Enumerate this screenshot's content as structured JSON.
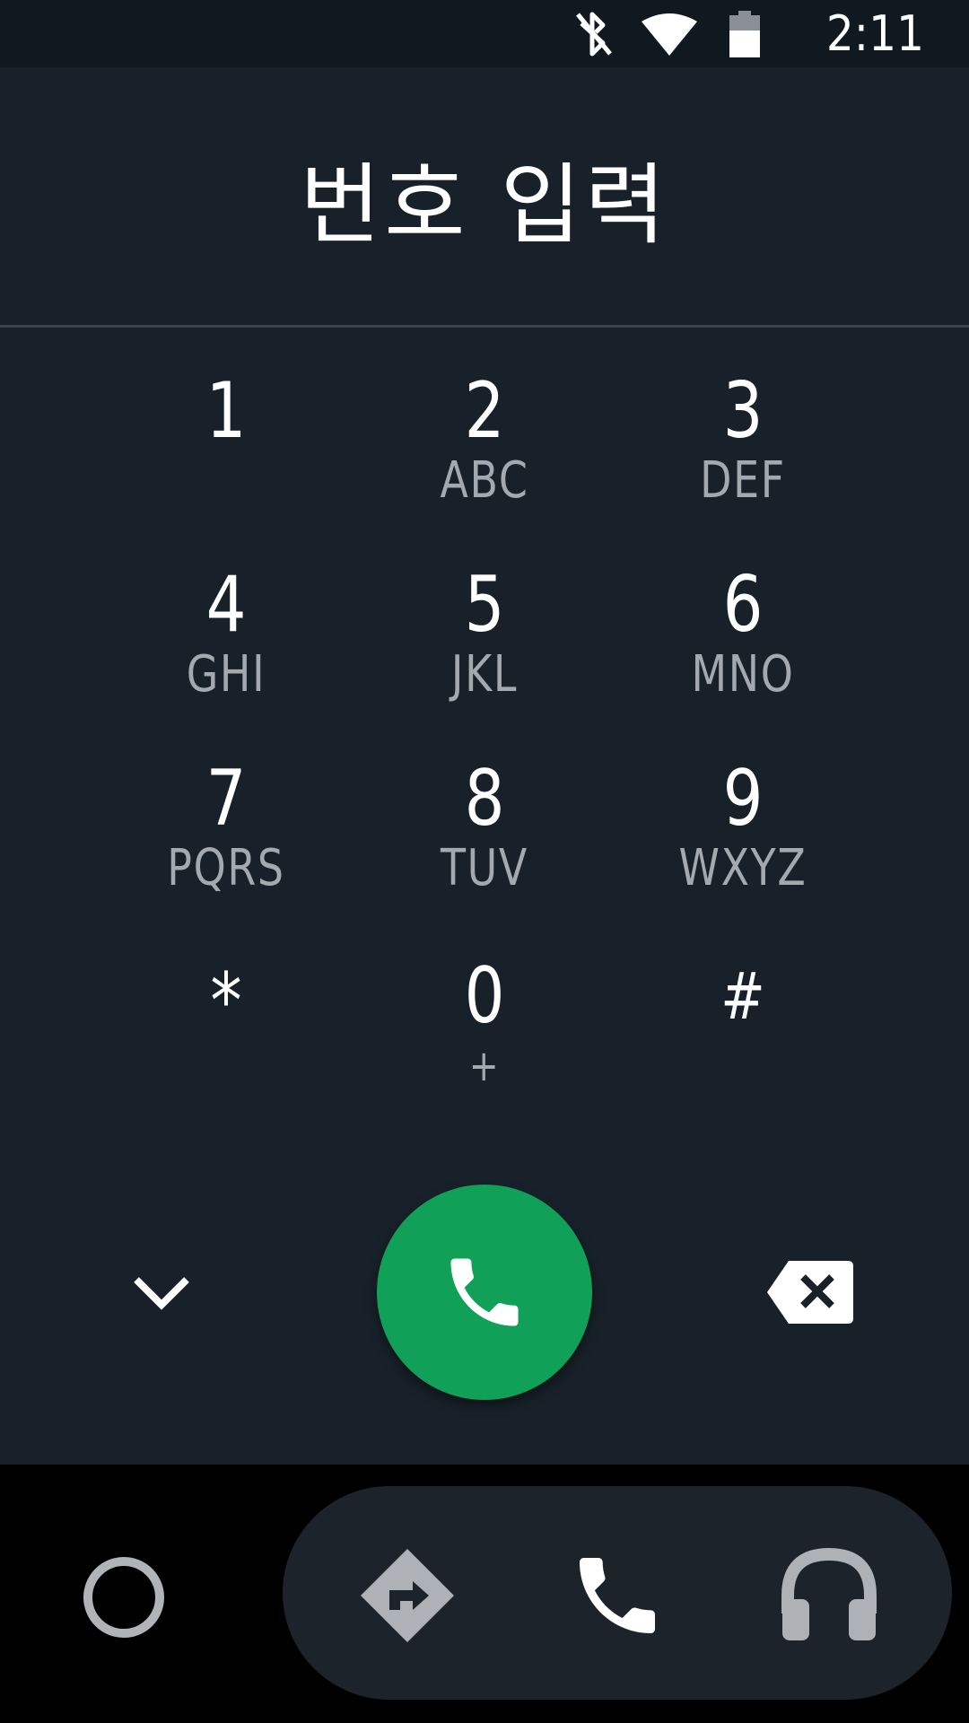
{
  "status_bar": {
    "time": "2:11",
    "icons": [
      "bluetooth-off-icon",
      "wifi-icon",
      "battery-icon"
    ]
  },
  "dialer": {
    "title": "번호 입력",
    "keys": [
      {
        "digit": "1",
        "letters": ""
      },
      {
        "digit": "2",
        "letters": "ABC"
      },
      {
        "digit": "3",
        "letters": "DEF"
      },
      {
        "digit": "4",
        "letters": "GHI"
      },
      {
        "digit": "5",
        "letters": "JKL"
      },
      {
        "digit": "6",
        "letters": "MNO"
      },
      {
        "digit": "7",
        "letters": "PQRS"
      },
      {
        "digit": "8",
        "letters": "TUV"
      },
      {
        "digit": "9",
        "letters": "WXYZ"
      },
      {
        "digit": "*",
        "letters": ""
      },
      {
        "digit": "0",
        "letters": "+"
      },
      {
        "digit": "#",
        "letters": ""
      }
    ],
    "actions": {
      "collapse_icon": "chevron-down-icon",
      "call_icon": "phone-icon",
      "call_color": "#10a057",
      "delete_icon": "backspace-icon"
    }
  },
  "nav_bar": {
    "home_icon": "home-circle-icon",
    "items": [
      "navigation-icon",
      "phone-icon",
      "headphones-icon"
    ]
  },
  "colors": {
    "background": "#18212a",
    "status_bar": "#111920",
    "text_primary": "#ffffff",
    "text_secondary": "#a3a9ae",
    "call_button": "#10a057",
    "nav_pill": "#1c232b"
  }
}
